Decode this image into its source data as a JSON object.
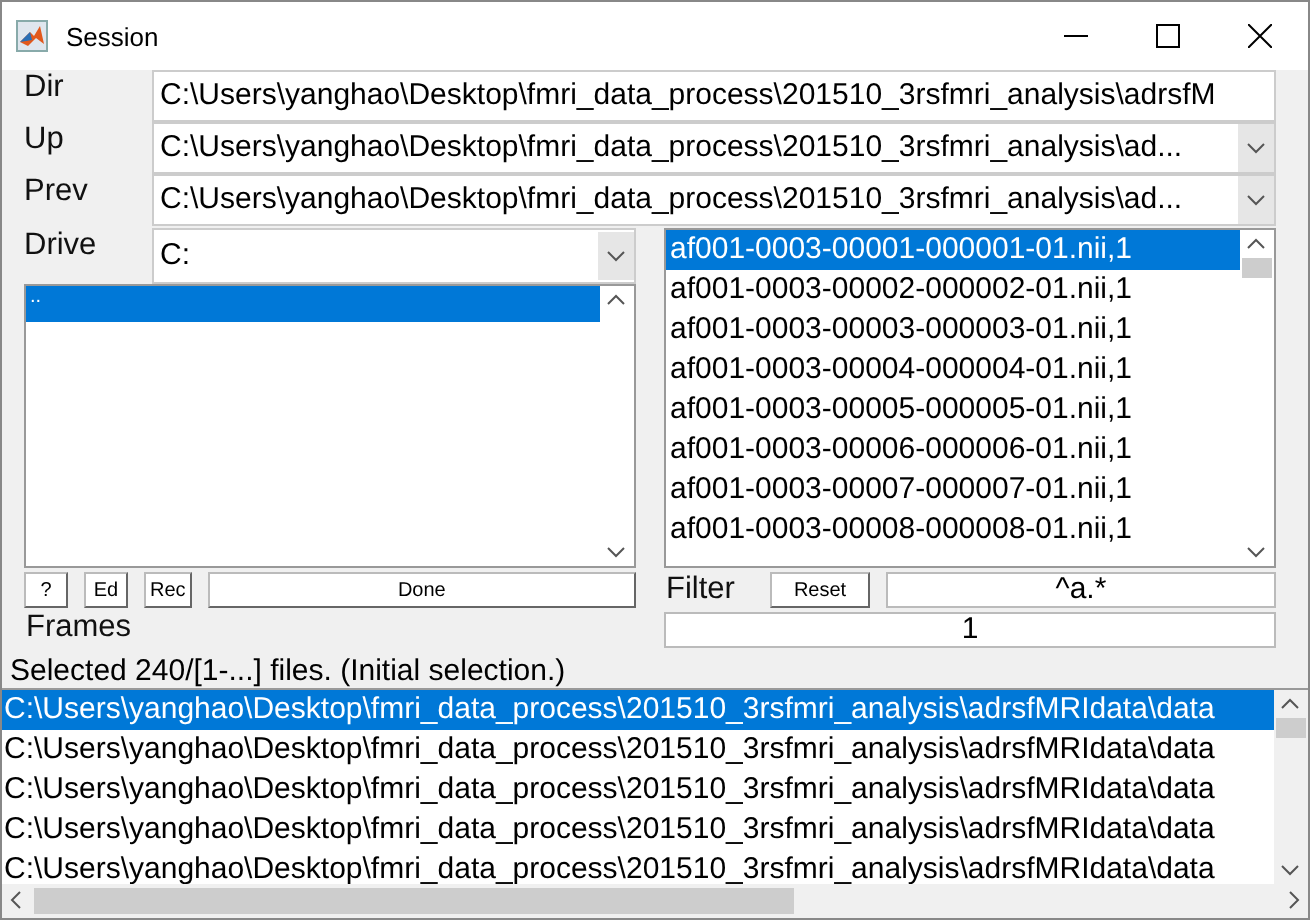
{
  "window": {
    "title": "Session"
  },
  "paths": [
    {
      "label": "Dir",
      "value": "C:\\Users\\yanghao\\Desktop\\fmri_data_process\\201510_3rsfmri_analysis\\adrsfM",
      "kind": "field"
    },
    {
      "label": "Up",
      "value": "C:\\Users\\yanghao\\Desktop\\fmri_data_process\\201510_3rsfmri_analysis\\ad...",
      "kind": "dropdown"
    },
    {
      "label": "Prev",
      "value": "C:\\Users\\yanghao\\Desktop\\fmri_data_process\\201510_3rsfmri_analysis\\ad...",
      "kind": "dropdown"
    }
  ],
  "drive": {
    "label": "Drive",
    "value": "C:"
  },
  "directories": [
    {
      "name": "..",
      "selected": true
    }
  ],
  "files": [
    {
      "name": "af001-0003-00001-000001-01.nii,1",
      "selected": true
    },
    {
      "name": "af001-0003-00002-000002-01.nii,1",
      "selected": false
    },
    {
      "name": "af001-0003-00003-000003-01.nii,1",
      "selected": false
    },
    {
      "name": "af001-0003-00004-000004-01.nii,1",
      "selected": false
    },
    {
      "name": "af001-0003-00005-000005-01.nii,1",
      "selected": false
    },
    {
      "name": "af001-0003-00006-000006-01.nii,1",
      "selected": false
    },
    {
      "name": "af001-0003-00007-000007-01.nii,1",
      "selected": false
    },
    {
      "name": "af001-0003-00008-000008-01.nii,1",
      "selected": false
    }
  ],
  "buttons": [
    "?",
    "Ed",
    "Rec",
    "Done"
  ],
  "filter": {
    "label": "Filter",
    "reset": "Reset",
    "value": "^a.*"
  },
  "frames": {
    "label": "Frames",
    "value": "1"
  },
  "status": "Selected 240/[1-...] files. (Initial selection.)",
  "selected_files": [
    {
      "path": "C:\\Users\\yanghao\\Desktop\\fmri_data_process\\201510_3rsfmri_analysis\\adrsfMRIdata\\data",
      "selected": true
    },
    {
      "path": "C:\\Users\\yanghao\\Desktop\\fmri_data_process\\201510_3rsfmri_analysis\\adrsfMRIdata\\data",
      "selected": false
    },
    {
      "path": "C:\\Users\\yanghao\\Desktop\\fmri_data_process\\201510_3rsfmri_analysis\\adrsfMRIdata\\data",
      "selected": false
    },
    {
      "path": "C:\\Users\\yanghao\\Desktop\\fmri_data_process\\201510_3rsfmri_analysis\\adrsfMRIdata\\data",
      "selected": false
    },
    {
      "path": "C:\\Users\\yanghao\\Desktop\\fmri_data_process\\201510_3rsfmri_analysis\\adrsfMRIdata\\data",
      "selected": false
    }
  ]
}
